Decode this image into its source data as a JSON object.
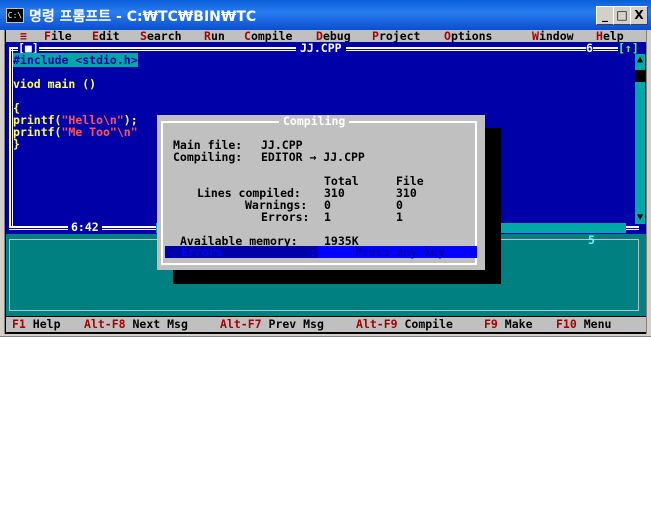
{
  "window": {
    "sys_icon": "C:\\",
    "title": "명령 프롬프트 - C:₩TC₩BIN₩TC",
    "controls": {
      "minimize": "_",
      "maximize": "□",
      "close": "X"
    }
  },
  "menu": {
    "system": "≡",
    "items": [
      "File",
      "Edit",
      "Search",
      "Run",
      "Compile",
      "Debug",
      "Project",
      "Options",
      "Window",
      "Help"
    ]
  },
  "editor": {
    "filename": "JJ.CPP",
    "window_number": "6",
    "close_box": "[■]",
    "zoom_box": "[↑]",
    "lines": [
      {
        "text": "#include <stdio.h>",
        "style": "selected"
      },
      {
        "text": "",
        "style": ""
      },
      {
        "text": "viod main ()",
        "style": ""
      },
      {
        "text": "",
        "style": ""
      },
      {
        "text": "{",
        "style": ""
      },
      {
        "pre": "printf(",
        "str": "\"Hello\\n\"",
        "post": ");",
        "style": ""
      },
      {
        "pre": "printf(",
        "str": "\"Me Too\"\\n\"",
        "post": "",
        "style": ""
      },
      {
        "text": "}",
        "style": ""
      }
    ],
    "cursor_pos": "6:42"
  },
  "message_window": {
    "number": "5"
  },
  "dialog": {
    "title": "Compiling",
    "main_file_label": "Main file:",
    "main_file": "JJ.CPP",
    "compiling_label": "Compiling:",
    "compiling_value": "EDITOR → JJ.CPP",
    "col_total": "Total",
    "col_file": "File",
    "rows": [
      {
        "label": "Lines compiled:",
        "total": "310",
        "file": "310"
      },
      {
        "label": "Warnings:",
        "total": "0",
        "file": "0"
      },
      {
        "label": "Errors:",
        "total": "1",
        "file": "1"
      }
    ],
    "memory_label": "Available memory:",
    "memory_value": "1935K",
    "result_label": "Errors",
    "result_sep": ":",
    "result_prompt": "Press any key"
  },
  "status": [
    {
      "key": "F1",
      "label": "Help"
    },
    {
      "key": "Alt-F8",
      "label": "Next Msg"
    },
    {
      "key": "Alt-F7",
      "label": "Prev Msg"
    },
    {
      "key": "Alt-F9",
      "label": "Compile"
    },
    {
      "key": "F9",
      "label": "Make"
    },
    {
      "key": "F10",
      "label": "Menu"
    }
  ],
  "colors": {
    "editor_bg": "#0000a8",
    "code_text": "#ffff55",
    "string_literal": "#ff5555",
    "dialog_bg": "#c0c0c0",
    "message_bg": "#008080",
    "hotkey": "#a80000"
  }
}
